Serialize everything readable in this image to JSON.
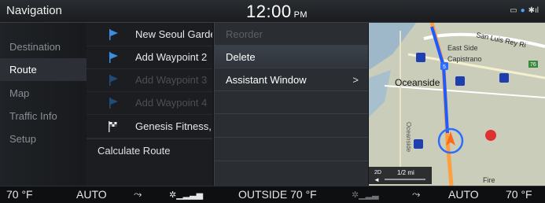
{
  "topbar": {
    "title": "Navigation",
    "clock": "12:00",
    "ampm": "PM"
  },
  "sidebar": {
    "items": [
      {
        "label": "Destination",
        "active": false
      },
      {
        "label": "Route",
        "active": true
      },
      {
        "label": "Map",
        "active": false
      },
      {
        "label": "Traffic Info",
        "active": false
      },
      {
        "label": "Setup",
        "active": false
      }
    ]
  },
  "route_list": {
    "items": [
      {
        "label": "New Seoul Garde",
        "icon": "flag-icon",
        "dim": false
      },
      {
        "label": "Add Waypoint 2",
        "icon": "flag-icon",
        "dim": false
      },
      {
        "label": "Add Waypoint 3",
        "icon": "flag-icon",
        "dim": true
      },
      {
        "label": "Add Waypoint 4",
        "icon": "flag-icon",
        "dim": true
      },
      {
        "label": "Genesis Fitness, :",
        "icon": "checkered-flag-icon",
        "dim": false
      }
    ],
    "calculate": "Calculate Route"
  },
  "popup": {
    "items": [
      {
        "label": "Reorder",
        "state": "disabled"
      },
      {
        "label": "Delete",
        "state": "selected"
      },
      {
        "label": "Assistant Window",
        "state": "normal",
        "has_arrow": true
      }
    ]
  },
  "map": {
    "labels": {
      "san_luis": "San Luis Rey Ri",
      "east_side": "East Side",
      "capistrano": "Capistrano",
      "oceanside": "Oceanside",
      "oceanside_vertical": "Oceanside",
      "fire": "Fire"
    },
    "route_shield": "5",
    "highway_badge": "76",
    "scale_mode": "2D",
    "scale_text": "1/2 mi",
    "colors": {
      "route": "#1e5cff",
      "land": "#c9cdb9",
      "water": "#9fb8c9"
    }
  },
  "bottombar": {
    "temp_left": "70 °F",
    "auto_left": "AUTO",
    "outside": "OUTSIDE 70 °F",
    "auto_right": "AUTO",
    "temp_right": "70 °F"
  }
}
